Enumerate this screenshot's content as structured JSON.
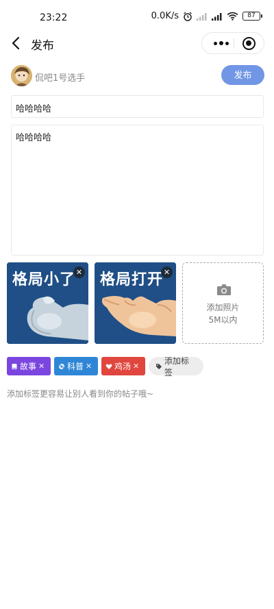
{
  "status_bar": {
    "time": "23:22",
    "net_speed": "0.0K/s",
    "battery": "87"
  },
  "nav": {
    "title": "发布"
  },
  "author": {
    "name": "侃吧1号选手",
    "publish_label": "发布"
  },
  "post": {
    "title_value": "哈哈哈哈",
    "content_value": "哈哈哈哈"
  },
  "photos": [
    {
      "caption": "格局小了",
      "icon": "close-icon"
    },
    {
      "caption": "格局打开",
      "icon": "close-icon"
    }
  ],
  "add_photo": {
    "label": "添加照片",
    "hint": "5M以内"
  },
  "tags": [
    {
      "label": "故事",
      "icon": "book-icon",
      "color": "#7b46df"
    },
    {
      "label": "科普",
      "icon": "atom-icon",
      "color": "#2f86d6"
    },
    {
      "label": "鸡汤",
      "icon": "heart-icon",
      "color": "#e0463e"
    }
  ],
  "add_tag_label": "添加标签",
  "hint": "添加标签更容易让别人看到你的帖子哦~"
}
